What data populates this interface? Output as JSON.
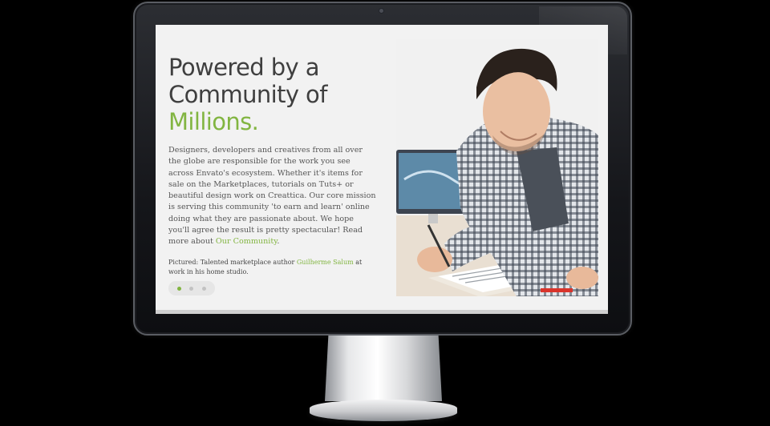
{
  "hero": {
    "headline_line1": "Powered by a",
    "headline_line2": "Community of",
    "headline_accent": "Millions.",
    "body": "Designers, developers and creatives from all over the globe are responsible for the work you see across Envato's ecosystem. Whether it's items for sale on the Marketplaces, tutorials on Tuts+ or beautiful design work on Creattica. Our core mission is serving this community 'to earn and learn' online doing what they are passionate about. We hope you'll agree the result is pretty spectacular! Read more about ",
    "body_link": "Our Community",
    "body_end": ".",
    "caption_prefix": "Pictured: Talented marketplace author ",
    "caption_link": "Guilherme Salum",
    "caption_suffix": " at work in his home studio."
  },
  "carousel": {
    "total": 3,
    "active_index": 1
  },
  "colors": {
    "accent": "#82b541",
    "heading": "#3f3f3f",
    "body": "#555555",
    "screen_bg": "#f2f2f2"
  }
}
